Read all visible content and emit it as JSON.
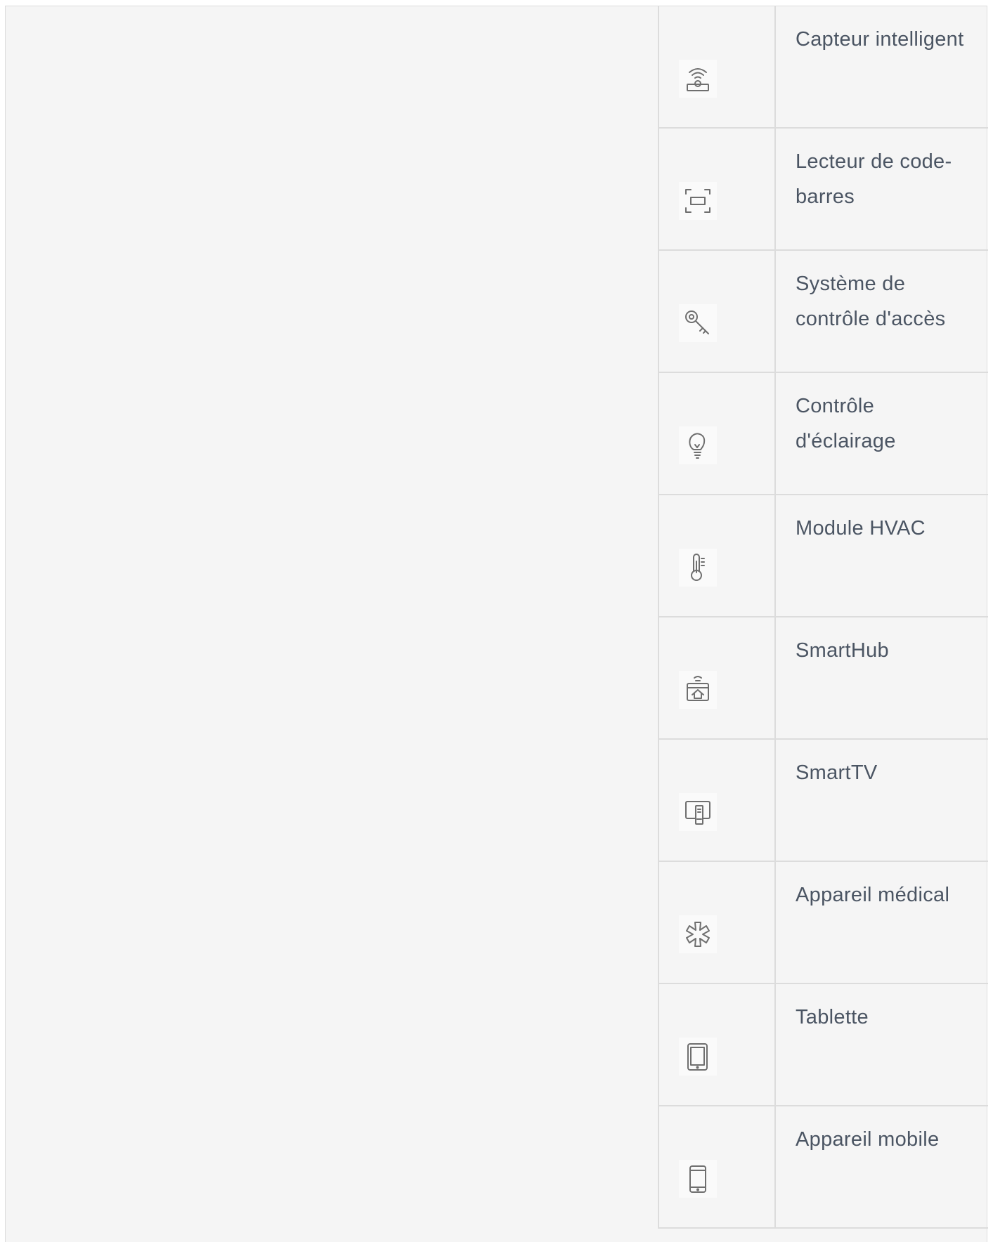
{
  "devices": [
    {
      "icon": "smart-sensor-icon",
      "label": "Capteur intelligent"
    },
    {
      "icon": "barcode-scanner-icon",
      "label": "Lecteur de code-barres"
    },
    {
      "icon": "key-icon",
      "label": "Système de contrôle d'accès"
    },
    {
      "icon": "lightbulb-icon",
      "label": "Contrôle d'éclairage"
    },
    {
      "icon": "thermometer-icon",
      "label": "Module HVAC"
    },
    {
      "icon": "smarthub-icon",
      "label": "SmartHub"
    },
    {
      "icon": "smarttv-icon",
      "label": "SmartTV"
    },
    {
      "icon": "medical-icon",
      "label": "Appareil médical"
    },
    {
      "icon": "tablet-icon",
      "label": "Tablette"
    },
    {
      "icon": "mobile-phone-icon",
      "label": "Appareil mobile"
    }
  ],
  "colors": {
    "background": "#f5f5f5",
    "border": "#dcdcdc",
    "text": "#4b5563",
    "icon": "#6f6f6f"
  }
}
